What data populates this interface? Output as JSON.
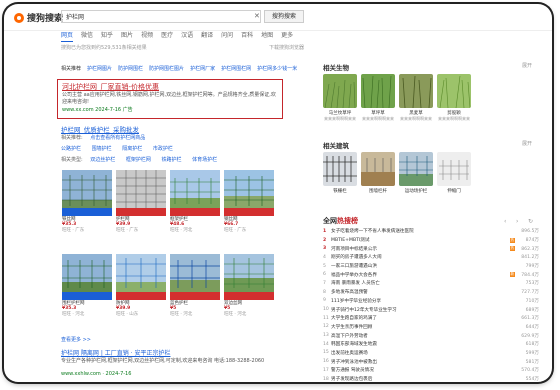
{
  "header": {
    "logo_text": "搜狗搜索",
    "query": "护栏网",
    "search_button": "搜狗搜索"
  },
  "tabs": [
    {
      "label": "网页"
    },
    {
      "label": "微信"
    },
    {
      "label": "知乎"
    },
    {
      "label": "图片"
    },
    {
      "label": "视频"
    },
    {
      "label": "医疗"
    },
    {
      "label": "汉语"
    },
    {
      "label": "翻译"
    },
    {
      "label": "问问"
    },
    {
      "label": "百科"
    },
    {
      "label": "地图"
    },
    {
      "label": "更多"
    }
  ],
  "result_count": "搜狗已为您找到约529,531条相关结果",
  "tools": "下载搜狗浏览器",
  "sub_tabs": [
    "相关推荐",
    "护栏网图片",
    "防护网围栏",
    "防护网围栏图片",
    "护栏网厂家",
    "护栏网围栏网",
    "护栏网多少钱一米"
  ],
  "result1": {
    "title": "河北护栏网_厂家直销-价格优惠",
    "desc": "公司主营 aa应用护栏网,铁丝网,钢筋网,护栏网,双边丝,框架护栏网等。产品规格齐全,质量保证,欢迎来电咨询!",
    "meta": "www.xx.com  2024-7-16  广告"
  },
  "wiki": {
    "title": "护栏网_优质护栏_采购批发",
    "row1_label": "相关推荐:",
    "row1_text": "点击查看所有护栏网商品",
    "row2": [
      "公路护栏",
      "围墙护栏",
      "隔离护栏",
      "市政护栏"
    ],
    "row3_label": "相关类型:",
    "row3": [
      "双边丝护栏",
      "框架护栏网",
      "铁路护栏",
      "体育场护栏"
    ]
  },
  "products": [
    {
      "name": "铁丝网",
      "price": "¥35.3",
      "meta": "旺旺 · 广东"
    },
    {
      "name": "护栏网",
      "price": "¥39.9",
      "meta": "旺旺 · 广东"
    },
    {
      "name": "框架护栏",
      "price": "¥48.6",
      "meta": "旺旺 · 河北"
    },
    {
      "name": "钢丝网",
      "price": "¥66.7",
      "meta": "旺旺 · 广东"
    },
    {
      "name": "围栏护栏网",
      "price": "¥35.3",
      "meta": "旺旺 · 河北"
    },
    {
      "name": "防护网",
      "price": "¥39.9",
      "meta": "旺旺 · 山东"
    },
    {
      "name": "蓝色护栏",
      "price": "¥5",
      "meta": "旺旺 · 河北"
    },
    {
      "name": "双边丝网",
      "price": "¥5",
      "meta": "旺旺 · 河北"
    }
  ],
  "more_link": "查看更多 >>",
  "result2": {
    "title": "护栏网 隔离网 | 工厂直销 · 安平正宗护栏",
    "desc": "专业生产各种护栏网,框架护栏网,双边丝护栏网,可定制,欢迎来电咨询 电话:188-3288-2060",
    "url": "www.xxhlw.com · 2024-7-16"
  },
  "result3": {
    "title": "www.ayanqm.com · 2024-7-4"
  },
  "right": {
    "related_label": "相关生物",
    "related_more": "展开",
    "related": [
      {
        "name": "马兰纹草坪",
        "sub": "来来来啊啊啊来来"
      },
      {
        "name": "草坪草",
        "sub": "来来来啊啊啊来来"
      },
      {
        "name": "黑麦草",
        "sub": "来来来啊啊啊来来"
      },
      {
        "name": "剪股颖",
        "sub": "来来来啊啊啊来来"
      }
    ],
    "related2_label": "相关建筑",
    "related2_more": "展开",
    "related2": [
      {
        "name": "铁栅栏"
      },
      {
        "name": "围墙栏杆"
      },
      {
        "name": "运动场护栏"
      },
      {
        "name": "伸缩门"
      }
    ],
    "hot_title_a": "全网",
    "hot_title_b": "热搜榜",
    "hot": [
      {
        "rank": "1",
        "text": "女子吃着烧烤一下不省人事发病送往医院",
        "heat": "896.5万",
        "tag": ""
      },
      {
        "rank": "2",
        "text": "MBTIE+MBTI测试",
        "heat": "874万",
        "tag": "热"
      },
      {
        "rank": "3",
        "text": "河南项目中标结果公示",
        "heat": "862.3万",
        "tag": "热"
      },
      {
        "rank": "4",
        "text": "刚买的房子遭遇多人大闹",
        "heat": "841.2万",
        "tag": ""
      },
      {
        "rank": "5",
        "text": "一家三口旅游遭遇山洪",
        "heat": "799万",
        "tag": ""
      },
      {
        "rank": "6",
        "text": "福品中学举办大会各界",
        "heat": "784.4万",
        "tag": "新"
      },
      {
        "rank": "7",
        "text": "海南 暴雨暴发 人员伤亡",
        "heat": "753万",
        "tag": ""
      },
      {
        "rank": "8",
        "text": "多地发布高温预警",
        "heat": "727.7万",
        "tag": ""
      },
      {
        "rank": "9",
        "text": "111岁中学毕业经验分享",
        "heat": "710万",
        "tag": ""
      },
      {
        "rank": "10",
        "text": "男子骑行中12年大专毕业生学习",
        "heat": "689万",
        "tag": ""
      },
      {
        "rank": "11",
        "text": "大学生跑自家的鸡满了",
        "heat": "661.3万",
        "tag": ""
      },
      {
        "rank": "12",
        "text": "大学生亲历事件回顾",
        "heat": "644万",
        "tag": ""
      },
      {
        "rank": "13",
        "text": "高温下户外劳动者",
        "heat": "629.9万",
        "tag": ""
      },
      {
        "rank": "14",
        "text": "韩国东部海域发生地震",
        "heat": "618万",
        "tag": ""
      },
      {
        "rank": "15",
        "text": "出发前往奥运赛场",
        "heat": "599万",
        "tag": ""
      },
      {
        "rank": "16",
        "text": "男子冲到泳池中被救出",
        "heat": "581万",
        "tag": ""
      },
      {
        "rank": "17",
        "text": "警方通报 驾驶员情况",
        "heat": "570.4万",
        "tag": ""
      },
      {
        "rank": "18",
        "text": "男子发现路边包裹后",
        "heat": "554万",
        "tag": ""
      },
      {
        "rank": "19",
        "text": "女子高速路段遭遇意外",
        "heat": "529万",
        "tag": ""
      },
      {
        "rank": "20",
        "text": "城市暴雨 车辆涉水",
        "heat": "511万",
        "tag": ""
      }
    ]
  },
  "colors": {
    "accent": "#1a5fd7",
    "highlight": "#c4262b",
    "url_green": "#0a7a1c"
  }
}
